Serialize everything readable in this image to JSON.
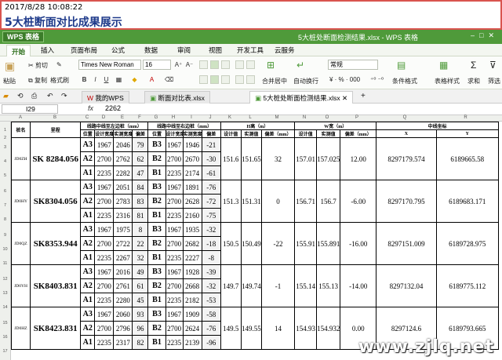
{
  "banner": {
    "timestamp": "2017/8/28 10:08:22",
    "title": "5大桩断面对比成果展示"
  },
  "app": {
    "wps_button": "WPS 表格",
    "window_title": "5大桩处断面检测结果.xlsx - WPS 表格",
    "accent": "#4f9a3a"
  },
  "menu_tabs": [
    "开始",
    "插入",
    "页面布局",
    "公式",
    "数据",
    "审阅",
    "视图",
    "开发工具",
    "云服务"
  ],
  "ribbon": {
    "cut": "剪切",
    "copy": "复制",
    "paste": "粘贴",
    "format_painter": "格式刷",
    "font_name": "Times New Roman",
    "font_size": "16",
    "merge_center": "合并居中",
    "wrap_text": "自动换行",
    "number_format": "常规",
    "conditional_format": "条件格式",
    "table_style": "表格样式",
    "sum": "求和",
    "filter": "筛选"
  },
  "doc_tabs": [
    "我的WPS",
    "断面对比表.xlsx",
    "5大桩处断面检测结果.xlsx"
  ],
  "formula_bar": {
    "cell": "I29",
    "fx": "fx",
    "value": "2262"
  },
  "column_letters": [
    "A",
    "B",
    "C",
    "D",
    "E",
    "F",
    "G",
    "H",
    "I",
    "J",
    "K",
    "L",
    "M",
    "N",
    "O",
    "P",
    "Q",
    "R"
  ],
  "row_numbers": [
    "1",
    "2",
    "3",
    "4",
    "5",
    "6",
    "7",
    "8",
    "9",
    "10",
    "11",
    "12",
    "13",
    "14",
    "15",
    "16",
    "17"
  ],
  "table": {
    "headers": {
      "pile_no": "桩名",
      "station": "里程",
      "left_group": "线路中线至左边桩（mm）",
      "right_group": "线路中线至右边桩（mm）",
      "pos": "位置",
      "design_width": "设计宽度",
      "measured_width": "实测宽度",
      "deviation": "偏差",
      "h_group": "H高（m）",
      "design_value": "设计值",
      "measured_value": "实测值",
      "dev_mm": "偏差（mm）",
      "w_group": "W宽（m）",
      "dev_mm2": "偏差（mm）",
      "center_group": "中线坐标",
      "x": "X",
      "y": "Y"
    },
    "sections": [
      {
        "pile": "JD0ZH",
        "station": "SK 8284.056",
        "h_design": "151.6",
        "h_measured": "151.65",
        "h_dev": "32",
        "w_design": "157.01",
        "w_measured": "157.025",
        "w_dev": "12.00",
        "x": "8297179.574",
        "y": "6189665.58",
        "rows": [
          {
            "lp": "A3",
            "ld": "1967",
            "lm": "2046",
            "ldev": "79",
            "rp": "B3",
            "rd": "1967",
            "rm": "1946",
            "rdev": "-21"
          },
          {
            "lp": "A2",
            "ld": "2700",
            "lm": "2762",
            "ldev": "62",
            "rp": "B2",
            "rd": "2700",
            "rm": "2670",
            "rdev": "-30"
          },
          {
            "lp": "A1",
            "ld": "2235",
            "lm": "2282",
            "ldev": "47",
            "rp": "B1",
            "rd": "2235",
            "rm": "2174",
            "rdev": "-61"
          }
        ]
      },
      {
        "pile": "JD0HY",
        "station": "SK8304.056",
        "h_design": "151.3",
        "h_measured": "151.31",
        "h_dev": "0",
        "w_design": "156.71",
        "w_measured": "156.7",
        "w_dev": "-6.00",
        "x": "8297170.795",
        "y": "6189683.171",
        "rows": [
          {
            "lp": "A3",
            "ld": "1967",
            "lm": "2051",
            "ldev": "84",
            "rp": "B3",
            "rd": "1967",
            "rm": "1891",
            "rdev": "-76"
          },
          {
            "lp": "A2",
            "ld": "2700",
            "lm": "2783",
            "ldev": "83",
            "rp": "B2",
            "rd": "2700",
            "rm": "2628",
            "rdev": "-72"
          },
          {
            "lp": "A1",
            "ld": "2235",
            "lm": "2316",
            "ldev": "81",
            "rp": "B1",
            "rd": "2235",
            "rm": "2160",
            "rdev": "-75"
          }
        ]
      },
      {
        "pile": "JD0QZ",
        "station": "SK8353.944",
        "h_design": "150.5",
        "h_measured": "150.49",
        "h_dev": "-22",
        "w_design": "155.91",
        "w_measured": "155.891",
        "w_dev": "-16.00",
        "x": "8297151.009",
        "y": "6189728.975",
        "rows": [
          {
            "lp": "A3",
            "ld": "1967",
            "lm": "1975",
            "ldev": "8",
            "rp": "B3",
            "rd": "1967",
            "rm": "1935",
            "rdev": "-32"
          },
          {
            "lp": "A2",
            "ld": "2700",
            "lm": "2722",
            "ldev": "22",
            "rp": "B2",
            "rd": "2700",
            "rm": "2682",
            "rdev": "-18"
          },
          {
            "lp": "A1",
            "ld": "2235",
            "lm": "2267",
            "ldev": "32",
            "rp": "B1",
            "rd": "2235",
            "rm": "2227",
            "rdev": "-8"
          }
        ]
      },
      {
        "pile": "JD0YH",
        "station": "SK8403.831",
        "h_design": "149.7",
        "h_measured": "149.74",
        "h_dev": "-1",
        "w_design": "155.14",
        "w_measured": "155.13",
        "w_dev": "-14.00",
        "x": "8297132.04",
        "y": "6189775.112",
        "rows": [
          {
            "lp": "A3",
            "ld": "1967",
            "lm": "2016",
            "ldev": "49",
            "rp": "B3",
            "rd": "1967",
            "rm": "1928",
            "rdev": "-39"
          },
          {
            "lp": "A2",
            "ld": "2700",
            "lm": "2761",
            "ldev": "61",
            "rp": "B2",
            "rd": "2700",
            "rm": "2668",
            "rdev": "-32"
          },
          {
            "lp": "A1",
            "ld": "2235",
            "lm": "2280",
            "ldev": "45",
            "rp": "B1",
            "rd": "2235",
            "rm": "2182",
            "rdev": "-53"
          }
        ]
      },
      {
        "pile": "JD0HZ",
        "station": "SK8423.831",
        "h_design": "149.5",
        "h_measured": "149.55",
        "h_dev": "14",
        "w_design": "154.93",
        "w_measured": "154.932",
        "w_dev": "0.00",
        "x": "8297124.6",
        "y": "6189793.665",
        "rows": [
          {
            "lp": "A3",
            "ld": "1967",
            "lm": "2060",
            "ldev": "93",
            "rp": "B3",
            "rd": "1967",
            "rm": "1909",
            "rdev": "-58"
          },
          {
            "lp": "A2",
            "ld": "2700",
            "lm": "2796",
            "ldev": "96",
            "rp": "B2",
            "rd": "2700",
            "rm": "2624",
            "rdev": "-76"
          },
          {
            "lp": "A1",
            "ld": "2235",
            "lm": "2317",
            "ldev": "82",
            "rp": "B1",
            "rd": "2235",
            "rm": "2139",
            "rdev": "-96"
          }
        ]
      }
    ]
  },
  "watermark": "www.zjlq.net"
}
